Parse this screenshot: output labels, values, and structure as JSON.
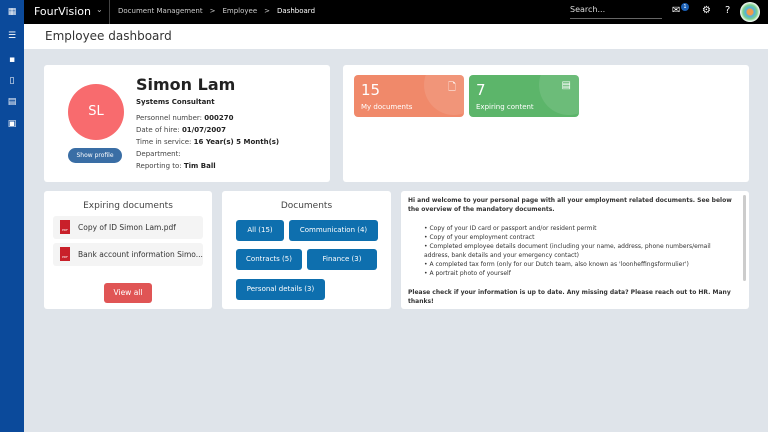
{
  "nav": {
    "brand": "FourVision",
    "breadcrumbs": [
      "Document Management",
      "Employee",
      "Dashboard"
    ],
    "search_placeholder": "Search...",
    "notification_count": "1"
  },
  "page_title": "Employee dashboard",
  "profile": {
    "initials": "SL",
    "name": "Simon Lam",
    "title": "Systems Consultant",
    "show_profile": "Show profile",
    "fields": [
      {
        "label": "Personnel number:",
        "value": "000270"
      },
      {
        "label": "Date of hire:",
        "value": "01/07/2007"
      },
      {
        "label": "Time in service:",
        "value": "16 Year(s) 5 Month(s)"
      },
      {
        "label": "Department:",
        "value": ""
      },
      {
        "label": "Reporting to:",
        "value": "Tim Ball"
      }
    ]
  },
  "tiles": [
    {
      "count": "15",
      "label": "My documents",
      "color": "#f0896a"
    },
    {
      "count": "7",
      "label": "Expiring content",
      "color": "#5cb56a"
    }
  ],
  "expiring": {
    "title": "Expiring documents",
    "items": [
      "Copy of ID Simon Lam.pdf",
      "Bank account information Simo..."
    ],
    "view_all": "View all",
    "pdf_label": "PDF"
  },
  "documents": {
    "title": "Documents",
    "buttons": [
      "All (15)",
      "Communication (4)",
      "Contracts (5)",
      "Finance (3)",
      "Personal details (3)"
    ]
  },
  "welcome": {
    "intro": "Hi and welcome to your personal page with all your employment related documents. See below the overview of the mandatory documents.",
    "items": [
      "Copy of your ID card or passport and/or resident permit",
      "Copy of your employment contract",
      "Completed employee details document (including your name, address, phone numbers/email address, bank details and your emergency contact)",
      "A completed tax form (only for our Dutch team, also known as 'loonheffingsformulier')",
      "A portrait photo of yourself"
    ],
    "outro": "Please check if your information is up to date. Any missing data? Please reach out to HR. Many thanks!"
  }
}
